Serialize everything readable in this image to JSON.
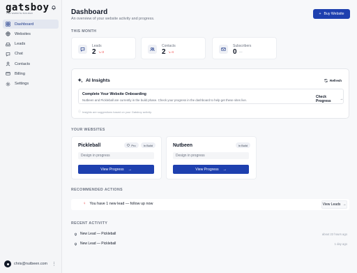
{
  "app": {
    "brand": "gatsboy",
    "brand_tagline": "THE WEBSITE BUILDER"
  },
  "sidebar": {
    "items": [
      {
        "label": "Dashboard",
        "icon": "dashboard-icon",
        "active": true
      },
      {
        "label": "Websites",
        "icon": "globe-icon",
        "active": false
      },
      {
        "label": "Leads",
        "icon": "inbox-icon",
        "active": false
      },
      {
        "label": "Chat",
        "icon": "chat-icon",
        "active": false
      },
      {
        "label": "Contacts",
        "icon": "user-icon",
        "active": false
      },
      {
        "label": "Billing",
        "icon": "card-icon",
        "active": false
      },
      {
        "label": "Settings",
        "icon": "gear-icon",
        "active": false
      }
    ],
    "user_email": "chris@nutbeen.com"
  },
  "header": {
    "title": "Dashboard",
    "subtitle": "An overview of your website activity and progress.",
    "buy_button": "Buy Website"
  },
  "this_month": {
    "label": "THIS MONTH",
    "stats": [
      {
        "label": "Leads",
        "value": "2",
        "delta": "↘-3"
      },
      {
        "label": "Contacts",
        "value": "2",
        "delta": "↘-4"
      },
      {
        "label": "Subscribers",
        "value": "0",
        "delta": "—"
      }
    ]
  },
  "ai": {
    "title": "AI Insights",
    "refresh": "Refresh",
    "card_title": "Complete Your Website Onboarding",
    "card_text": "Nutbeen and Pickleball are currently in the build phase. Check your progress in the dashboard to help get these sites live.",
    "card_button": "Check Progress",
    "note": "Insights are suggestions based on your Gatsboy activity."
  },
  "websites": {
    "label": "YOUR WEBSITES",
    "sites": [
      {
        "name": "Pickleball",
        "badges": [
          "Pro",
          "In Build"
        ],
        "status": "Design in progress",
        "button": "View Progress"
      },
      {
        "name": "Nutbeen",
        "badges": [
          "In Build"
        ],
        "status": "Design in progress",
        "button": "View Progress"
      }
    ]
  },
  "recommended": {
    "label": "RECOMMENDED ACTIONS",
    "text": "You have 1 new lead — follow up now",
    "button": "View Leads"
  },
  "activity": {
    "label": "RECENT ACTIVITY",
    "items": [
      {
        "text": "New Lead — Pickleball",
        "time": "about 22 hours ago"
      },
      {
        "text": "New Lead — Pickleball",
        "time": "1 day ago"
      }
    ]
  },
  "colors": {
    "accent": "#1e40af",
    "negative": "#ef4444",
    "active_nav_bg": "#e3e7f0"
  }
}
